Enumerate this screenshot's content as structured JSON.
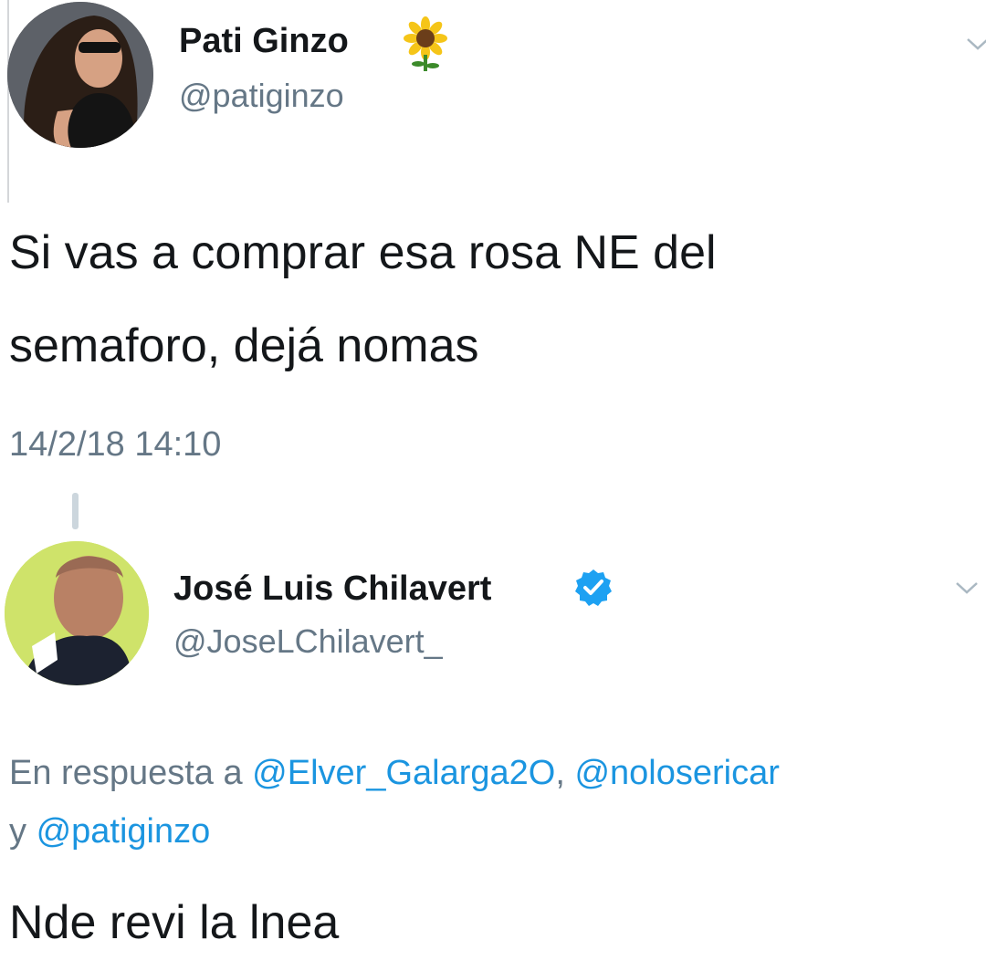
{
  "tweet1": {
    "display_name": "Pati Ginzo",
    "name_emoji": "sunflower-icon",
    "handle": "@patiginzo",
    "text_line1": "Si vas a comprar esa rosa NE del",
    "text_line2": "semaforo, dejá nomas",
    "timestamp": "14/2/18 14:10"
  },
  "tweet2": {
    "display_name": "José Luis Chilavert",
    "verified_badge": "verified-icon",
    "handle": "@JoseLChilavert_",
    "reply_prefix": "En respuesta a ",
    "reply_mention1": "@Elver_Galarga2O",
    "reply_sep": ", ",
    "reply_mention2": "@noloseric​ar",
    "reply_and": "y ",
    "reply_mention3": "@patiginzo",
    "text": "Nde revi la lnea"
  },
  "colors": {
    "text": "#14171a",
    "secondary": "#657786",
    "link": "#1b95e0",
    "verified": "#1da1f2"
  }
}
